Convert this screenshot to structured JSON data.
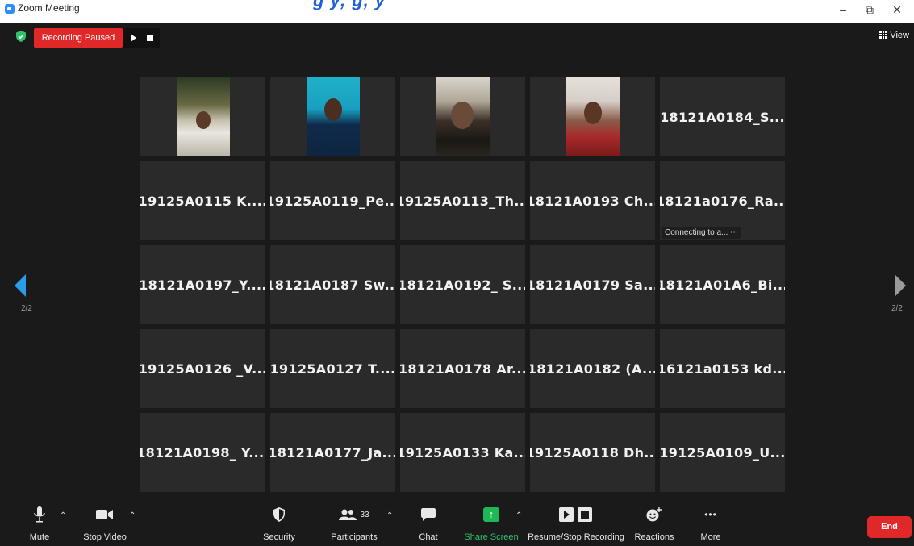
{
  "window": {
    "title": "Zoom Meeting",
    "banner_text": "g                          y,   g,                  y",
    "minimize": "–",
    "restore": "⧉",
    "close": "✕"
  },
  "meeting_bar": {
    "recording_status": "Recording Paused",
    "view_label": "View"
  },
  "gallery": {
    "tiles": [
      {
        "name": "",
        "video": true
      },
      {
        "name": "",
        "video": true
      },
      {
        "name": "",
        "video": true
      },
      {
        "name": "",
        "video": true
      },
      {
        "name": "18121A0184_S..."
      },
      {
        "name": "19125A0115  K...."
      },
      {
        "name": "19125A0119_Pe..."
      },
      {
        "name": "19125A0113_Th..."
      },
      {
        "name": "18121A0193  Ch..."
      },
      {
        "name": "18121a0176_Ra...",
        "status": "Connecting to a..."
      },
      {
        "name": "18121A0197_Y...."
      },
      {
        "name": "18121A0187  Sw..."
      },
      {
        "name": "18121A0192_  S..."
      },
      {
        "name": "18121A0179  Sa..."
      },
      {
        "name": "18121A01A6_Bi..."
      },
      {
        "name": "19125A0126  _V..."
      },
      {
        "name": "19125A0127  T...."
      },
      {
        "name": "18121A0178  Ar..."
      },
      {
        "name": "18121A0182  (A..."
      },
      {
        "name": "16121a0153  kd..."
      },
      {
        "name": "18121A0198_  Y...."
      },
      {
        "name": "18121A0177_Ja..."
      },
      {
        "name": "19125A0133  Ka..."
      },
      {
        "name": "19125A0118  Dh..."
      },
      {
        "name": "19125A0109_U..."
      }
    ]
  },
  "pager": {
    "left_page": "2/2",
    "right_page": "2/2"
  },
  "toolbar": {
    "mute": "Mute",
    "stop_video": "Stop Video",
    "security": "Security",
    "participants": "Participants",
    "participants_count": "33",
    "chat": "Chat",
    "share_screen": "Share Screen",
    "resume_stop_recording": "Resume/Stop Recording",
    "reactions": "Reactions",
    "more": "More",
    "more_glyph": "•••",
    "end": "End"
  },
  "colors": {
    "background": "#1a1a1a",
    "tile": "#2a2a2a",
    "recording_red": "#e02828",
    "share_green": "#1db954",
    "nav_blue": "#2d9ce8"
  }
}
